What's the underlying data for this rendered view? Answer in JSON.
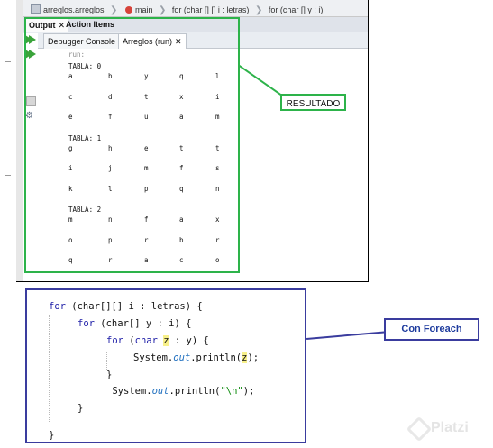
{
  "breadcrumb": {
    "items": [
      "arreglos.arreglos",
      "main",
      "for (char [] [] i : letras)",
      "for (char [] y : i)"
    ]
  },
  "output_tabs": {
    "output_label": "Output",
    "action_items_label": "Action Items"
  },
  "sub_tabs": {
    "debugger_label": "Debugger Console",
    "run_label": "Arreglos (run)"
  },
  "console": {
    "run_text": "run:",
    "tables": [
      {
        "label": "TABLA: 0",
        "rows": [
          [
            "a",
            "b",
            "y",
            "q",
            "l"
          ],
          [
            "c",
            "d",
            "t",
            "x",
            "i"
          ],
          [
            "e",
            "f",
            "u",
            "a",
            "m"
          ]
        ]
      },
      {
        "label": "TABLA: 1",
        "rows": [
          [
            "g",
            "h",
            "e",
            "t",
            "t"
          ],
          [
            "i",
            "j",
            "m",
            "f",
            "s"
          ],
          [
            "k",
            "l",
            "p",
            "q",
            "n"
          ]
        ]
      },
      {
        "label": "TABLA: 2",
        "rows": [
          [
            "m",
            "n",
            "f",
            "a",
            "x"
          ],
          [
            "o",
            "p",
            "r",
            "b",
            "r"
          ],
          [
            "q",
            "r",
            "a",
            "c",
            "o"
          ]
        ]
      }
    ]
  },
  "annotations": {
    "resultado": "RESULTADO",
    "con_foreach": "Con Foreach"
  },
  "code": {
    "l1_kw": "for",
    "l1_rest": " (char[][] i : letras) {",
    "l2_kw": "for",
    "l2_rest": " (char[] y : i) {",
    "l3_kw": "for",
    "l3_a": " (",
    "l3_char": "char",
    "l3_b": " ",
    "l3_z": "z",
    "l3_c": " : y) {",
    "l4_a": "System.",
    "l4_out": "out",
    "l4_b": ".println(",
    "l4_z": "z",
    "l4_c": ");",
    "l5": "}",
    "l6_a": " System.",
    "l6_out": "out",
    "l6_b": ".println(",
    "l6_str": "\"\\n\"",
    "l6_c": ");",
    "l7": "}",
    "l8": "}"
  },
  "watermark": "Platzi",
  "colors": {
    "green": "#2db34a",
    "blue_box": "#3a3c9e",
    "keyword": "#1f1fa8"
  }
}
